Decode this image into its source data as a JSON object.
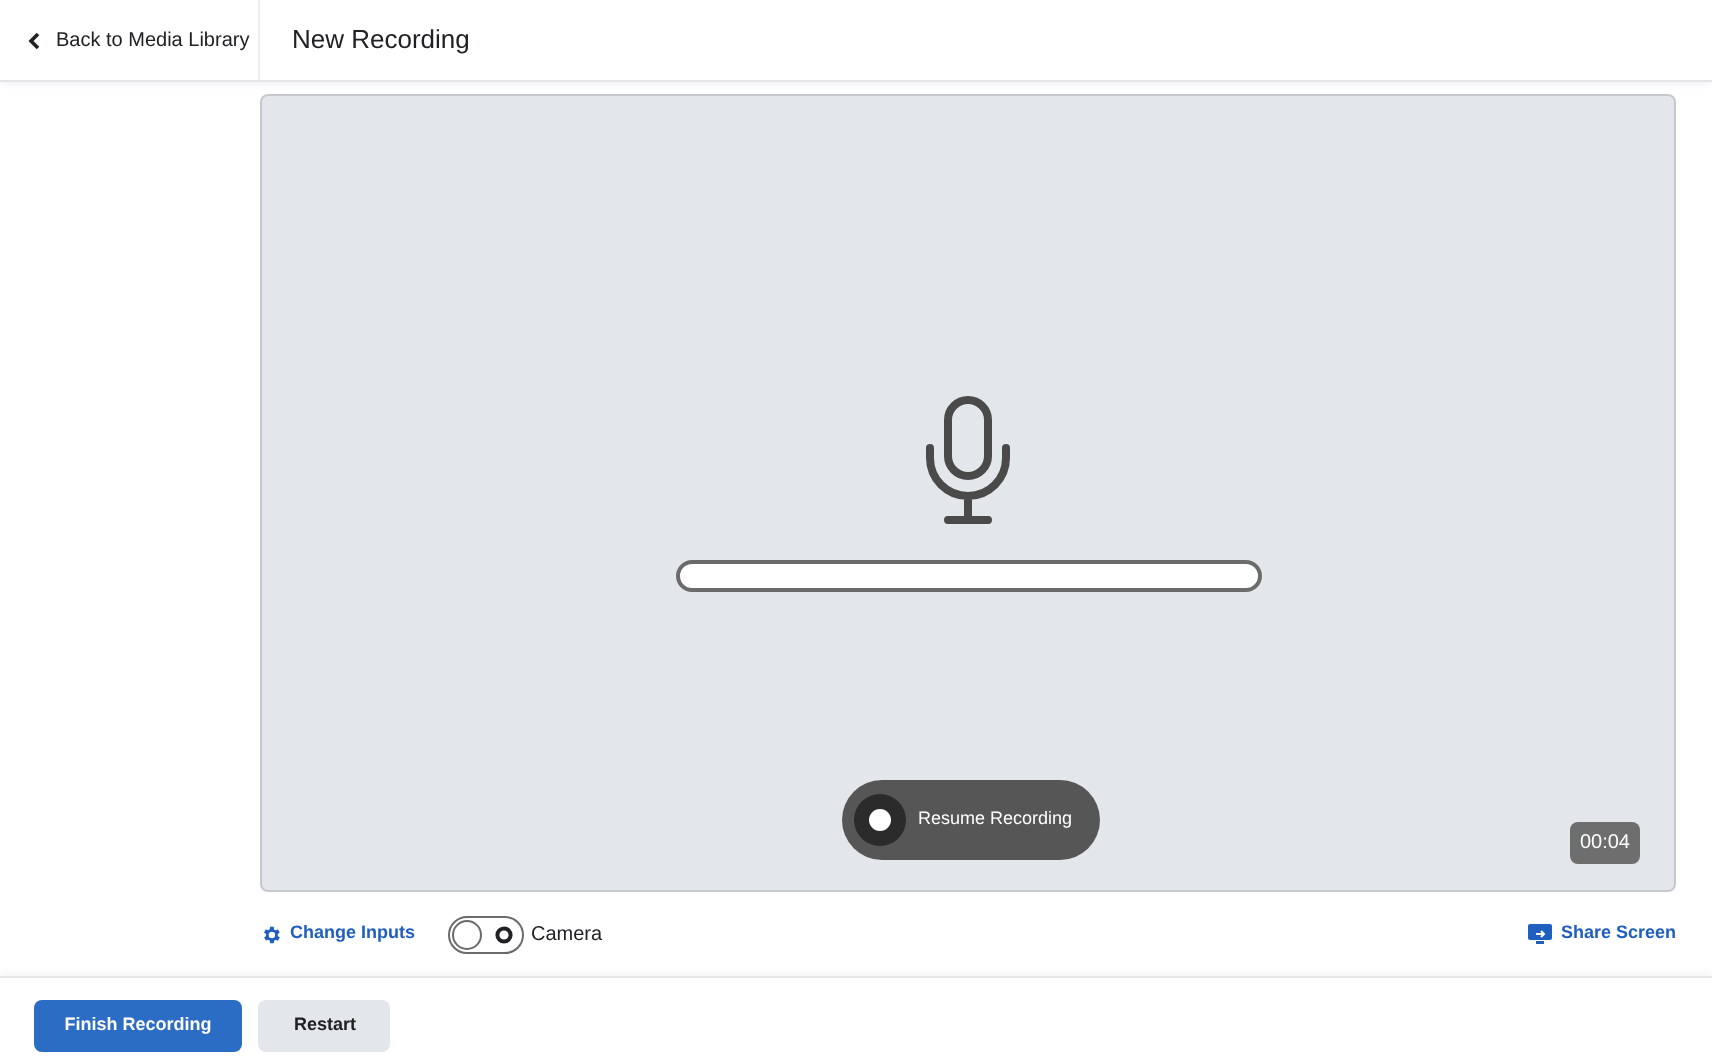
{
  "header": {
    "back_link": "Back to Media Library",
    "title": "New Recording"
  },
  "stage": {
    "audio_meter": {
      "level": 0
    },
    "resume_button": "Resume Recording",
    "timer": "00:04"
  },
  "controls": {
    "change_inputs": "Change Inputs",
    "camera": {
      "label": "Camera",
      "on": false
    },
    "share_screen": "Share Screen"
  },
  "footer": {
    "buttons": [
      {
        "label": "Finish Recording",
        "kind": "primary"
      },
      {
        "label": "Restart",
        "kind": "secondary"
      }
    ]
  }
}
